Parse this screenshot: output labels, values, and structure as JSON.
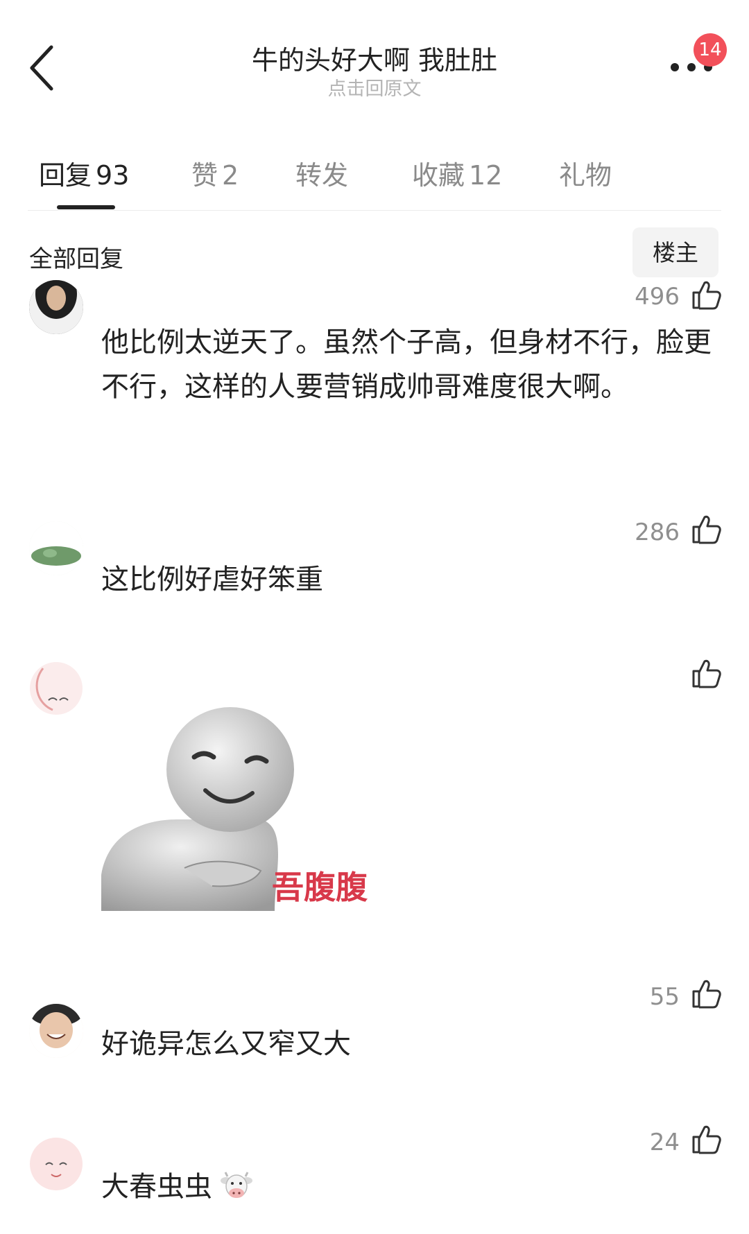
{
  "header": {
    "title": "牛的头好大啊 我肚肚",
    "subtitle": "点击回原文",
    "badge_count": "14",
    "icons": {
      "back": "chevron-left-icon",
      "more": "more-dots-icon"
    }
  },
  "tabs": [
    {
      "label": "回复",
      "count": "93",
      "active": true
    },
    {
      "label": "赞",
      "count": "2",
      "active": false
    },
    {
      "label": "转发",
      "count": "",
      "active": false
    },
    {
      "label": "收藏",
      "count": "12",
      "active": false
    },
    {
      "label": "礼物",
      "count": "",
      "active": false
    }
  ],
  "section": {
    "title": "全部回复",
    "owner_button": "楼主"
  },
  "comments": [
    {
      "text": "他比例太逆天了。虽然个子高，但身材不行，脸更不行，这样的人要营销成帅哥难度很大啊。",
      "likes": "496"
    },
    {
      "text": "这比例好虐好笨重",
      "likes": "286"
    },
    {
      "text": "",
      "likes": "",
      "sticker_caption": "吾腹腹"
    },
    {
      "text": "好诡异怎么又窄又大",
      "likes": "55"
    },
    {
      "text": "大春虫虫",
      "likes": "24",
      "emoji": "cow-face-icon"
    }
  ],
  "colors": {
    "badge": "#f2505a",
    "text_primary": "#222222",
    "text_secondary": "#8f8f8f",
    "sticker_caption": "#d8394a"
  }
}
